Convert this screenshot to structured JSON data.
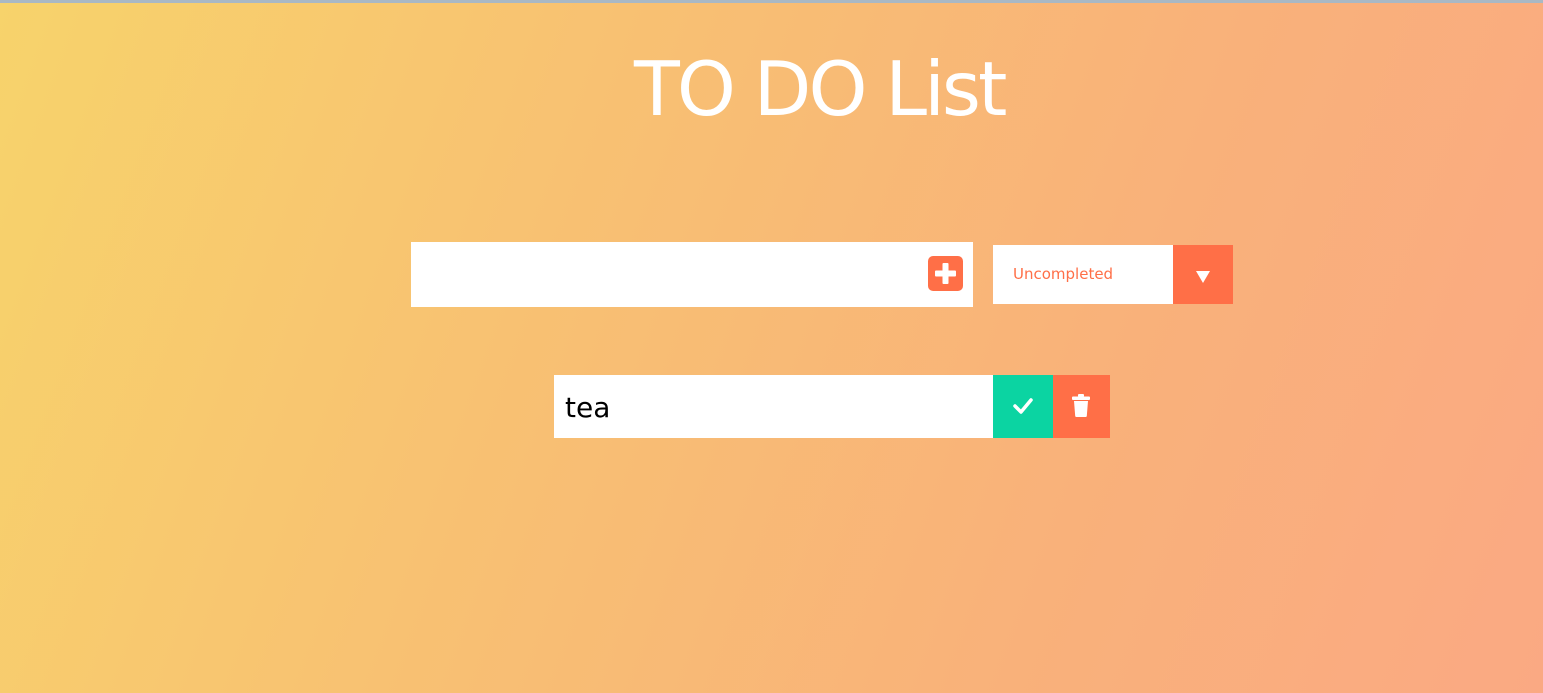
{
  "page": {
    "title": "TO DO List"
  },
  "form": {
    "input_value": "",
    "input_placeholder": "",
    "add_icon": "plus-square-icon"
  },
  "filter": {
    "selected": "Uncompleted",
    "arrow_icon": "triangle-down-icon"
  },
  "todos": [
    {
      "text": "tea",
      "complete_icon": "check-icon",
      "delete_icon": "trash-icon"
    }
  ],
  "colors": {
    "accent": "#ff6f47",
    "complete": "#0bd4a2",
    "title": "#ffffff"
  }
}
